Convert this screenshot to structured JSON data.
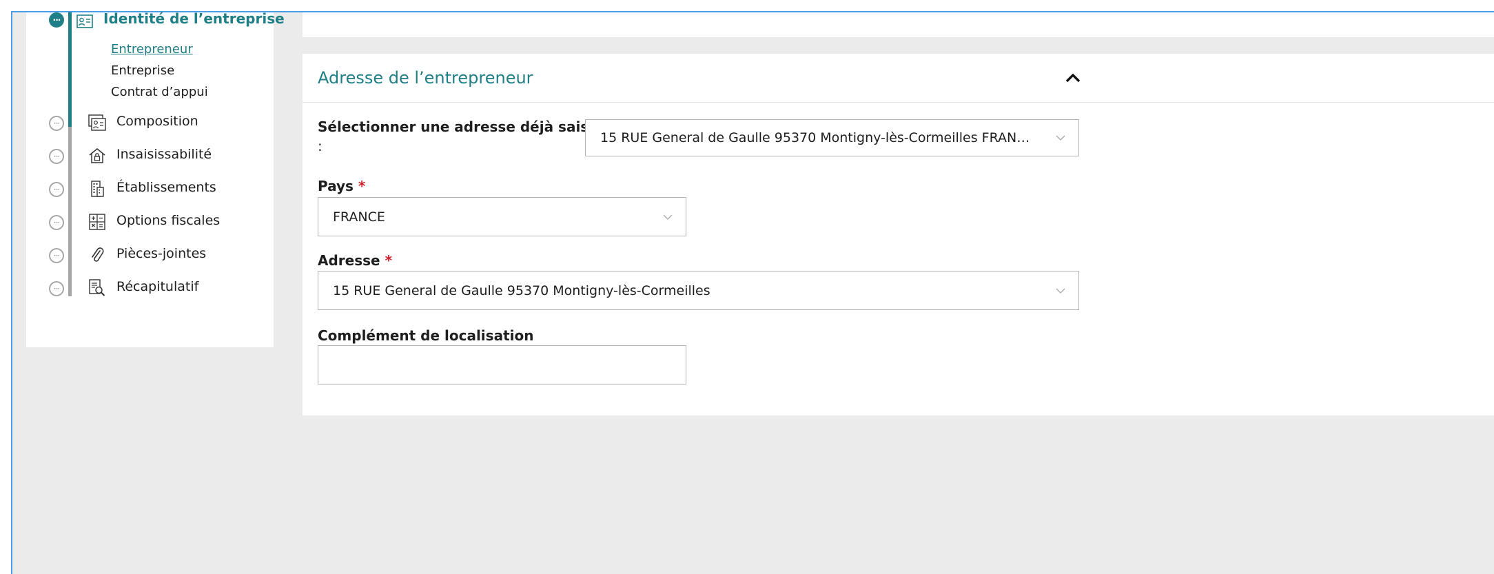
{
  "sidebar": {
    "steps": [
      {
        "label": "Identité de l’entreprise",
        "icon": "id-card-icon",
        "state": "current"
      },
      {
        "label": "Composition",
        "icon": "people-card-icon",
        "state": "todo"
      },
      {
        "label": "Insaisissabilité",
        "icon": "house-lock-icon",
        "state": "todo"
      },
      {
        "label": "Établissements",
        "icon": "building-icon",
        "state": "todo"
      },
      {
        "label": "Options fiscales",
        "icon": "calculator-icon",
        "state": "todo"
      },
      {
        "label": "Pièces-jointes",
        "icon": "paperclip-icon",
        "state": "todo"
      },
      {
        "label": "Récapitulatif",
        "icon": "document-search-icon",
        "state": "todo"
      }
    ],
    "sub_items": [
      {
        "label": "Entrepreneur",
        "current": true
      },
      {
        "label": "Entreprise",
        "current": false
      },
      {
        "label": "Contrat d’appui",
        "current": false
      }
    ],
    "dot_glyph": "···"
  },
  "card": {
    "title": "Adresse de l’entrepreneur",
    "collapse_icon": "chevron-up-icon"
  },
  "form": {
    "existing_address": {
      "label": "Sélectionner une adresse déjà saisie",
      "label_suffix": ":",
      "value": "15 RUE General de Gaulle 95370 Montigny-lès-Cormeilles FRAN…"
    },
    "country": {
      "label": "Pays",
      "required_mark": "*",
      "value": "FRANCE"
    },
    "address": {
      "label": "Adresse",
      "required_mark": "*",
      "value": "15 RUE General de Gaulle 95370 Montigny-lès-Cormeilles"
    },
    "complement": {
      "label": "Complément de localisation",
      "value": ""
    }
  },
  "colors": {
    "accent": "#1f7f86",
    "required": "#d0202a",
    "frame_border": "#4a9ee8",
    "background": "#ebebeb"
  }
}
